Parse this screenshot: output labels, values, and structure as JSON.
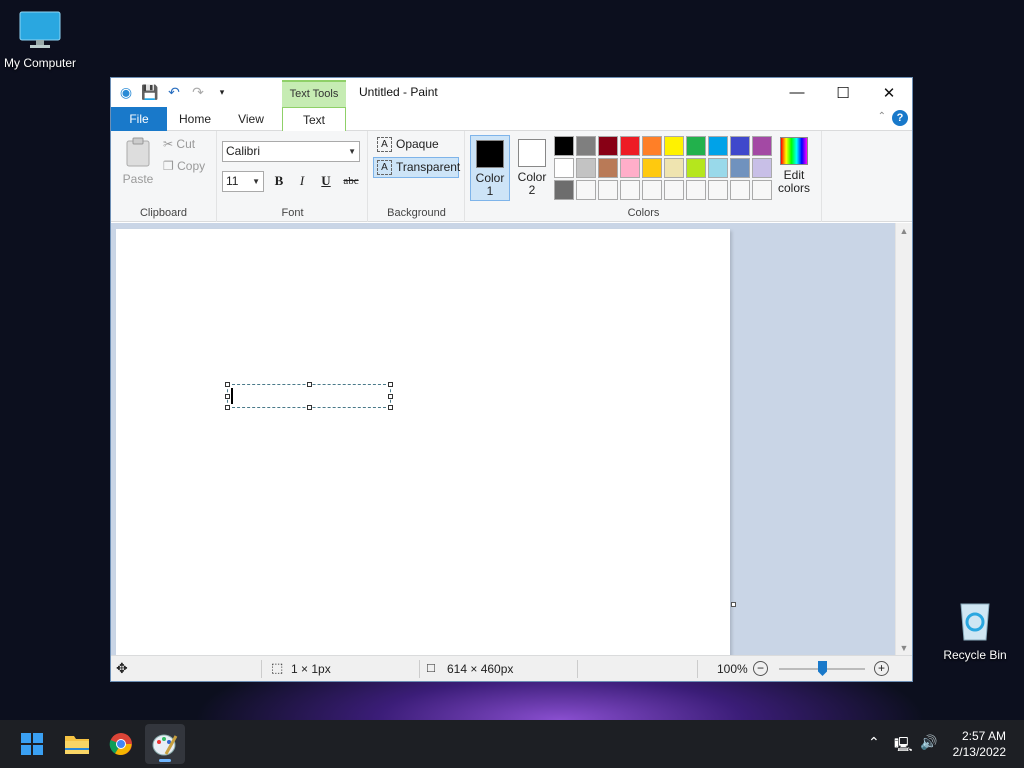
{
  "desktop": {
    "icons": [
      {
        "label": "My Computer",
        "icon": "monitor-icon"
      },
      {
        "label": "Recycle Bin",
        "icon": "recycle-bin-icon"
      }
    ]
  },
  "window": {
    "title": "Untitled - Paint",
    "context_tab_group": "Text Tools",
    "tabs": [
      "File",
      "Home",
      "View",
      "Text"
    ],
    "active_tab": "Text"
  },
  "ribbon": {
    "clipboard": {
      "paste": "Paste",
      "cut": "Cut",
      "copy": "Copy",
      "label": "Clipboard"
    },
    "font": {
      "family": "Calibri",
      "size": "11",
      "bold": "B",
      "italic": "I",
      "underline": "U",
      "strike": "abc",
      "label": "Font"
    },
    "background": {
      "opaque": "Opaque",
      "transparent": "Transparent",
      "selected": "Transparent",
      "label": "Background"
    },
    "colors": {
      "color1_label_a": "Color",
      "color1_label_b": "1",
      "color1": "#000000",
      "color2_label_a": "Color",
      "color2_label_b": "2",
      "color2": "#ffffff",
      "edit_a": "Edit",
      "edit_b": "colors",
      "label": "Colors",
      "palette": [
        "#000000",
        "#7f7f7f",
        "#880015",
        "#ed1c24",
        "#ff7f27",
        "#fff200",
        "#22b14c",
        "#00a2e8",
        "#3f48cc",
        "#a349a4",
        "#ffffff",
        "#c3c3c3",
        "#b97a57",
        "#ffaec9",
        "#ffc90e",
        "#efe4b0",
        "#b5e61d",
        "#99d9ea",
        "#7092be",
        "#c8bfe7",
        "#6d6d6d",
        "#f7f7f7",
        "#f7f7f7",
        "#f7f7f7",
        "#f7f7f7",
        "#f7f7f7",
        "#f7f7f7",
        "#f7f7f7",
        "#f7f7f7",
        "#f7f7f7"
      ]
    }
  },
  "status": {
    "selection_size": "1 × 1px",
    "canvas_size": "614 × 460px",
    "zoom": "100%",
    "zoom_level": 0.5
  },
  "taskbar": {
    "apps": [
      "start-icon",
      "file-explorer-icon",
      "chrome-icon",
      "paint-icon"
    ],
    "time": "2:57 AM",
    "date": "2/13/2022"
  }
}
